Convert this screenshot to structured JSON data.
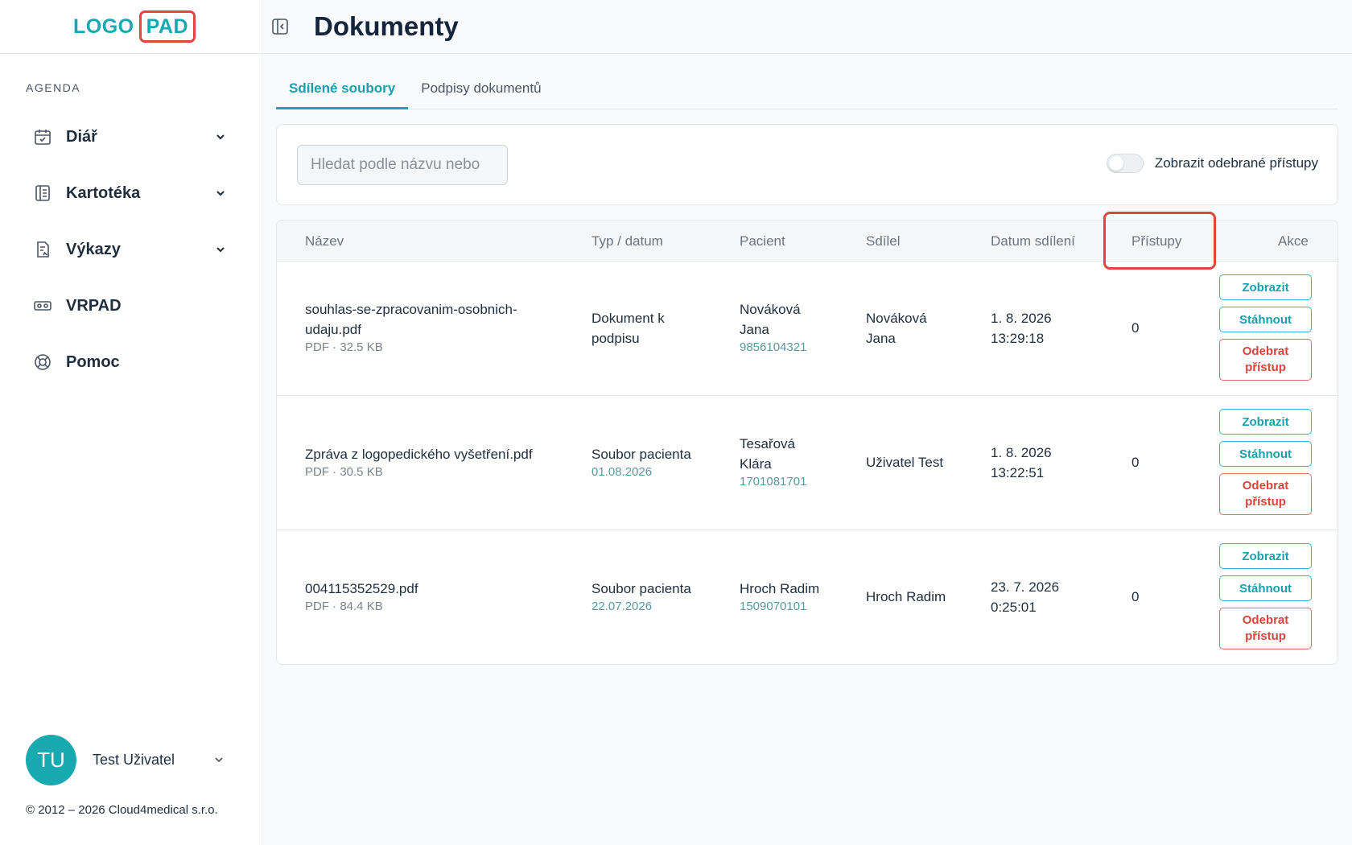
{
  "logo": {
    "part_a": "LOGO",
    "part_b": "PAD"
  },
  "sidebar": {
    "section_label": "AGENDA",
    "items": [
      {
        "label": "Diář",
        "icon": "calendar-icon",
        "has_chevron": true
      },
      {
        "label": "Kartotéka",
        "icon": "file-cabinet-icon",
        "has_chevron": true
      },
      {
        "label": "Výkazy",
        "icon": "report-icon",
        "has_chevron": true
      },
      {
        "label": "VRPAD",
        "icon": "vr-headset-icon",
        "has_chevron": false
      },
      {
        "label": "Pomoc",
        "icon": "lifebuoy-icon",
        "has_chevron": false
      }
    ],
    "user": {
      "initials": "TU",
      "name": "Test Uživatel"
    },
    "copyright": "© 2012 – 2026 Cloud4medical s.r.o."
  },
  "header": {
    "title": "Dokumenty"
  },
  "tabs": [
    {
      "label": "Sdílené soubory",
      "active": true
    },
    {
      "label": "Podpisy dokumentů",
      "active": false
    }
  ],
  "filter": {
    "search_placeholder": "Hledat podle názvu nebo",
    "toggle_label": "Zobrazit odebrané přístupy",
    "toggle_on": false
  },
  "table": {
    "columns": [
      "Název",
      "Typ / datum",
      "Pacient",
      "Sdílel",
      "Datum sdílení",
      "Přístupy",
      "Akce"
    ],
    "highlighted_column": "Přístupy",
    "rows": [
      {
        "name_line1": "souhlas-se-zpracovanim-osobnich-",
        "name_line2": "udaju.pdf",
        "file_info": "PDF · 32.5 KB",
        "type_line1": "Dokument k",
        "type_line2": "podpisu",
        "type_date": "",
        "patient_line1": "Nováková",
        "patient_line2": "Jana",
        "patient_id": "9856104321",
        "shared_by_line1": "Nováková",
        "shared_by_line2": "Jana",
        "date_line1": "1. 8. 2026",
        "date_line2": "13:29:18",
        "accesses": "0"
      },
      {
        "name_line1": "Zpráva z logopedického vyšetření.pdf",
        "name_line2": "",
        "file_info": "PDF · 30.5 KB",
        "type_line1": "Soubor pacienta",
        "type_line2": "",
        "type_date": "01.08.2026",
        "patient_line1": "Tesařová",
        "patient_line2": "Klára",
        "patient_id": "1701081701",
        "shared_by_line1": "Uživatel Test",
        "shared_by_line2": "",
        "date_line1": "1. 8. 2026",
        "date_line2": "13:22:51",
        "accesses": "0"
      },
      {
        "name_line1": "004115352529.pdf",
        "name_line2": "",
        "file_info": "PDF · 84.4 KB",
        "type_line1": "Soubor pacienta",
        "type_line2": "",
        "type_date": "22.07.2026",
        "patient_line1": "Hroch Radim",
        "patient_line2": "",
        "patient_id": "1509070101",
        "shared_by_line1": "Hroch Radim",
        "shared_by_line2": "",
        "date_line1": "23. 7. 2026",
        "date_line2": "0:25:01",
        "accesses": "0"
      }
    ],
    "actions": {
      "view": "Zobrazit",
      "download": "Stáhnout",
      "revoke_line1": "Odebrat",
      "revoke_line2": "přístup"
    }
  },
  "colors": {
    "accent": "#17a0ad",
    "danger": "#d8453c",
    "highlight": "#e0463f"
  }
}
